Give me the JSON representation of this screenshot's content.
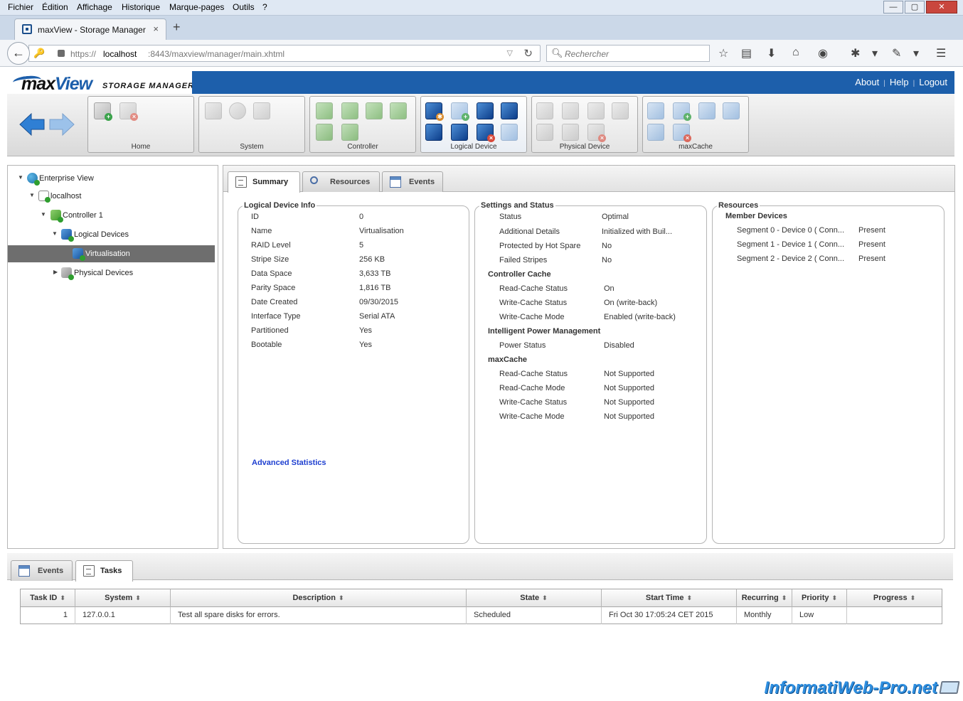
{
  "browser": {
    "menu": [
      "Fichier",
      "Édition",
      "Affichage",
      "Historique",
      "Marque-pages",
      "Outils",
      "?"
    ],
    "window_controls": {
      "minimize": "—",
      "maximize": "▢",
      "close": "✕"
    },
    "tab_title": "maxView - Storage Manager",
    "tab_close": "×",
    "new_tab": "+",
    "url_prefix": "https://",
    "url_host": "localhost",
    "url_rest": ":8443/maxview/manager/main.xhtml",
    "search_placeholder": "Rechercher"
  },
  "app": {
    "logo_max": "max",
    "logo_view": "View",
    "logo_sub": "STORAGE MANAGER",
    "header_links": [
      "About",
      "Help",
      "Logout"
    ],
    "header_sep": "|",
    "toolbar_groups": [
      "Home",
      "System",
      "Controller",
      "Logical Device",
      "Physical Device",
      "maxCache"
    ]
  },
  "tree": {
    "nodes": [
      "Enterprise View",
      "localhost",
      "Controller 1",
      "Logical Devices",
      "Virtualisation",
      "Physical Devices"
    ],
    "selected": "Virtualisation"
  },
  "main_tabs": [
    "Summary",
    "Resources",
    "Events"
  ],
  "logical_device_info": {
    "title": "Logical Device Info",
    "rows": [
      [
        "ID",
        "0"
      ],
      [
        "Name",
        "Virtualisation"
      ],
      [
        "RAID Level",
        "5"
      ],
      [
        "Stripe Size",
        "256 KB"
      ],
      [
        "Data Space",
        "3,633 TB"
      ],
      [
        "Parity Space",
        "1,816 TB"
      ],
      [
        "Date Created",
        "09/30/2015"
      ],
      [
        "Interface Type",
        "Serial ATA"
      ],
      [
        "Partitioned",
        "Yes"
      ],
      [
        "Bootable",
        "Yes"
      ]
    ],
    "advanced_link": "Advanced Statistics"
  },
  "settings_status": {
    "title": "Settings and Status",
    "rows": [
      [
        "Status",
        "Optimal"
      ],
      [
        "Additional Details",
        "Initialized with Buil..."
      ],
      [
        "Protected by Hot Spare",
        "No"
      ],
      [
        "Failed Stripes",
        "No"
      ]
    ],
    "controller_cache_title": "Controller Cache",
    "controller_cache": [
      [
        "Read-Cache Status",
        "On"
      ],
      [
        "Write-Cache Status",
        "On (write-back)"
      ],
      [
        "Write-Cache Mode",
        "Enabled (write-back)"
      ]
    ],
    "ipm_title": "Intelligent Power Management",
    "ipm": [
      [
        "Power Status",
        "Disabled"
      ]
    ],
    "maxcache_title": "maxCache",
    "maxcache": [
      [
        "Read-Cache Status",
        "Not Supported"
      ],
      [
        "Read-Cache Mode",
        "Not Supported"
      ],
      [
        "Write-Cache Status",
        "Not Supported"
      ],
      [
        "Write-Cache Mode",
        "Not Supported"
      ]
    ]
  },
  "resources": {
    "title": "Resources",
    "member_title": "Member Devices",
    "members": [
      [
        "Segment 0 - Device 0 ( Conn...",
        "Present"
      ],
      [
        "Segment 1 - Device 1 ( Conn...",
        "Present"
      ],
      [
        "Segment 2 - Device 2 ( Conn...",
        "Present"
      ]
    ]
  },
  "bottom_tabs": [
    "Events",
    "Tasks"
  ],
  "tasks_table": {
    "columns": [
      "Task ID",
      "System",
      "Description",
      "State",
      "Start Time",
      "Recurring",
      "Priority",
      "Progress"
    ],
    "rows": [
      [
        "1",
        "127.0.0.1",
        "Test all spare disks for errors.",
        "Scheduled",
        "Fri Oct 30 17:05:24 CET 2015",
        "Monthly",
        "Low",
        ""
      ]
    ]
  },
  "watermark": "InformatiWeb-Pro.net"
}
